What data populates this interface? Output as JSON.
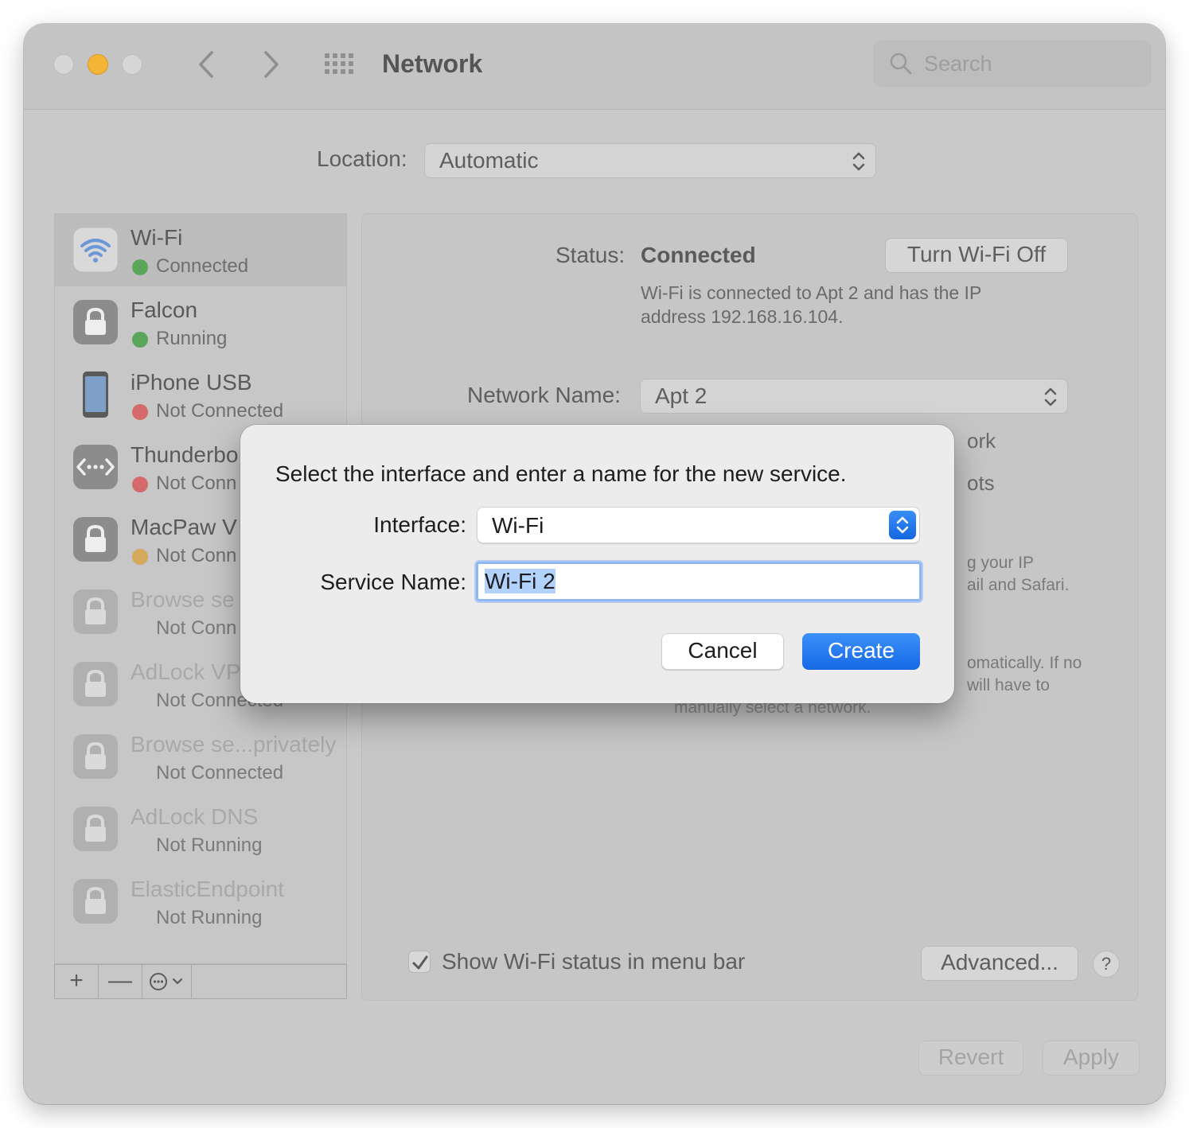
{
  "window": {
    "title": "Network",
    "search_placeholder": "Search"
  },
  "location": {
    "label": "Location:",
    "value": "Automatic"
  },
  "services": [
    {
      "name": "Wi-Fi",
      "status": "Connected",
      "status_color": "#5ba55b",
      "icon": "wifi-icon",
      "selected": true
    },
    {
      "name": "Falcon",
      "status": "Running",
      "status_color": "#5ba55b",
      "icon": "lock-icon"
    },
    {
      "name": "iPhone USB",
      "status": "Not Connected",
      "status_color": "#d46a6a",
      "icon": "iphone-icon"
    },
    {
      "name": "Thunderbo",
      "status": "Not Conn",
      "status_color": "#d46a6a",
      "icon": "thunderbolt-bridge-icon"
    },
    {
      "name": "MacPaw V",
      "status": "Not Conn",
      "status_color": "#d6a85a",
      "icon": "lock-icon"
    },
    {
      "name": "Browse se",
      "status": "Not Conn",
      "icon": "lock-icon"
    },
    {
      "name": "AdLock VP",
      "status": "Not Connected",
      "icon": "lock-icon"
    },
    {
      "name": "Browse se...privately",
      "status": "Not Connected",
      "icon": "lock-icon"
    },
    {
      "name": "AdLock DNS",
      "status": "Not Running",
      "icon": "lock-icon"
    },
    {
      "name": "ElasticEndpoint",
      "status": "Not Running",
      "icon": "lock-icon"
    }
  ],
  "sidebar_toolbar": {
    "add": "+",
    "remove": "—"
  },
  "detail": {
    "status_label": "Status:",
    "status_value": "Connected",
    "turn_off_button": "Turn Wi-Fi Off",
    "status_description": "Wi-Fi is connected to Apt 2 and has the IP address 192.168.16.104.",
    "network_name_label": "Network Name:",
    "network_name_value": "Apt 2",
    "clipped_1": "ork",
    "clipped_2": "ots",
    "clipped_3": "g your IP",
    "clipped_4": "ail and Safari.",
    "clipped_5": "omatically. If no",
    "clipped_6": "will have to",
    "clipped_7": "manually select a network.",
    "show_status_label": "Show Wi-Fi status in menu bar",
    "show_status_checked": true,
    "advanced_button": "Advanced...",
    "help_button": "?"
  },
  "footer": {
    "revert_button": "Revert",
    "apply_button": "Apply"
  },
  "sheet": {
    "message": "Select the interface and enter a name for the new service.",
    "interface_label": "Interface:",
    "interface_value": "Wi-Fi",
    "service_name_label": "Service Name:",
    "service_name_value": "Wi-Fi 2",
    "cancel_button": "Cancel",
    "create_button": "Create"
  },
  "colors": {
    "accent": "#1a6ee6",
    "traffic_yellow": "#f4b536"
  }
}
